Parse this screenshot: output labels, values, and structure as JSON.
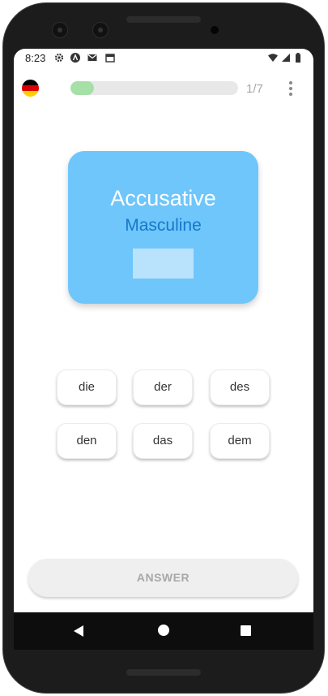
{
  "status_bar": {
    "time": "8:23",
    "icons": [
      "settings-icon",
      "app-a-icon",
      "gmail-icon",
      "calendar-icon",
      "wifi-icon",
      "signal-icon",
      "battery-icon"
    ]
  },
  "header": {
    "flag": "german-flag-icon",
    "flag_colors": [
      "#000000",
      "#DD0000",
      "#FFCE00"
    ],
    "progress": 0.14,
    "progress_color": "#a5e0a7",
    "counter": "1/7",
    "menu_icon": "more-vertical-icon"
  },
  "card": {
    "case": "Accusative",
    "gender": "Masculine",
    "color": "#6ec6fb",
    "gender_color": "#1777c8"
  },
  "options": [
    "die",
    "der",
    "des",
    "den",
    "das",
    "dem"
  ],
  "answer_button": "ANSWER",
  "nav_bar": {
    "back_icon": "back-icon",
    "home_icon": "home-icon",
    "recents_icon": "recents-icon"
  }
}
